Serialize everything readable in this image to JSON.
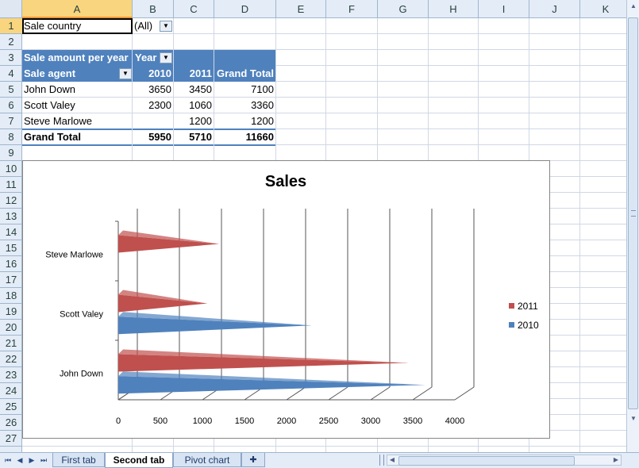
{
  "columns": [
    "A",
    "B",
    "C",
    "D",
    "E",
    "F",
    "G",
    "H",
    "I",
    "J",
    "K"
  ],
  "rows": [
    "1",
    "2",
    "3",
    "4",
    "5",
    "6",
    "7",
    "8",
    "9",
    "10",
    "11",
    "12",
    "13",
    "14",
    "15",
    "16",
    "17",
    "18",
    "19",
    "20",
    "21",
    "22",
    "23",
    "24",
    "25",
    "26",
    "27"
  ],
  "selected_column": "A",
  "selected_row": "1",
  "filter": {
    "label": "Sale country",
    "value": "(All)"
  },
  "pivot": {
    "caption": "Sale amount per year",
    "year_label": "Year",
    "row_label": "Sale agent",
    "year_headers": [
      "2010",
      "2011"
    ],
    "grand_total_label": "Grand Total",
    "rows": [
      {
        "agent": "John Down",
        "v2010": "3650",
        "v2011": "3450",
        "total": "7100"
      },
      {
        "agent": "Scott Valey",
        "v2010": "2300",
        "v2011": "1060",
        "total": "3360"
      },
      {
        "agent": "Steve Marlowe",
        "v2010": "",
        "v2011": "1200",
        "total": "1200"
      }
    ],
    "grand_total_row": {
      "label": "Grand Total",
      "v2010": "5950",
      "v2011": "5710",
      "total": "11660"
    }
  },
  "chart_data": {
    "type": "bar",
    "title": "Sales",
    "categories": [
      "John Down",
      "Scott Valey",
      "Steve Marlowe"
    ],
    "series": [
      {
        "name": "2010",
        "values": [
          3650,
          2300,
          0
        ],
        "color": "#4f81bd"
      },
      {
        "name": "2011",
        "values": [
          3450,
          1060,
          1200
        ],
        "color": "#c0504d"
      }
    ],
    "x_ticks": [
      "0",
      "500",
      "1000",
      "1500",
      "2000",
      "2500",
      "3000",
      "3500",
      "4000"
    ],
    "xlim": [
      0,
      4000
    ],
    "grid": true,
    "legend_position": "right",
    "orientation": "horizontal"
  },
  "sheet_tabs": [
    {
      "label": "First tab",
      "active": false
    },
    {
      "label": "Second tab",
      "active": true
    },
    {
      "label": "Pivot chart",
      "active": false
    }
  ],
  "icons": {
    "dropdown": "dropdown-arrow-icon",
    "new_sheet": "insert-sheet-icon"
  }
}
